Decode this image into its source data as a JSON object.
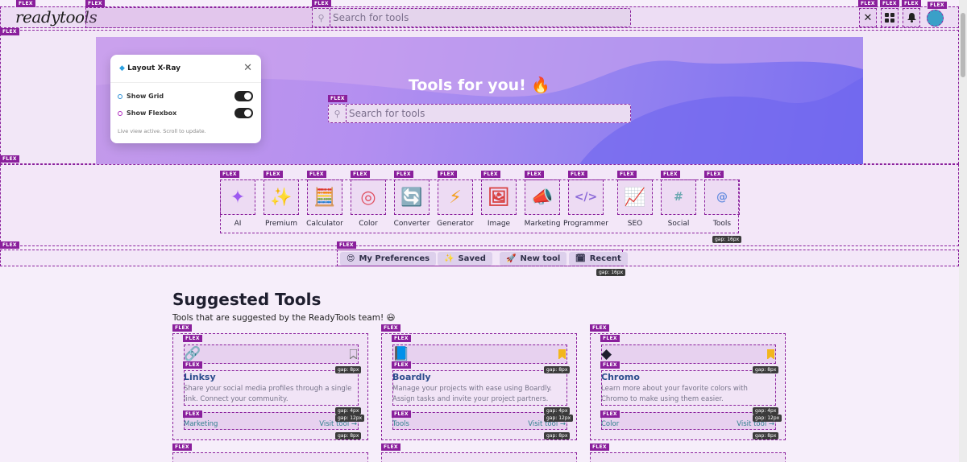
{
  "header": {
    "logo": "readytools",
    "search_placeholder": "Search for tools",
    "icons": [
      "tools-icon",
      "apps-icon",
      "bell-icon",
      "avatar"
    ]
  },
  "hero": {
    "title": "Tools for you! 🔥",
    "search_placeholder": "Search for tools"
  },
  "xray_panel": {
    "title": "Layout X-Ray",
    "show_grid": "Show Grid",
    "show_flexbox": "Show Flexbox",
    "footer": "Live view active. Scroll to update."
  },
  "categories": [
    {
      "label": "AI",
      "icon": "✦"
    },
    {
      "label": "Premium",
      "icon": "✨"
    },
    {
      "label": "Calculator",
      "icon": "🧮"
    },
    {
      "label": "Color",
      "icon": "◎"
    },
    {
      "label": "Converter",
      "icon": "🔄"
    },
    {
      "label": "Generator",
      "icon": "⚡"
    },
    {
      "label": "Image",
      "icon": "🖼"
    },
    {
      "label": "Marketing",
      "icon": "📣"
    },
    {
      "label": "Programmer",
      "icon": "</>"
    },
    {
      "label": "SEO",
      "icon": "📈"
    },
    {
      "label": "Social",
      "icon": "#"
    },
    {
      "label": "Tools",
      "icon": "@"
    }
  ],
  "preferences": [
    {
      "label": "My Preferences",
      "icon": "😍"
    },
    {
      "label": "Saved",
      "icon": "✨"
    },
    {
      "label": "New tool",
      "icon": "🚀"
    },
    {
      "label": "Recent",
      "icon": "🗓"
    }
  ],
  "overlay": {
    "flex_tag": "FLEX",
    "gap16": "gap: 16px",
    "gap8": "gap: 8px",
    "gap4": "gap: 4px",
    "gap12": "gap: 12px"
  },
  "suggested": {
    "title": "Suggested Tools",
    "subtitle": "Tools that are suggested by the ReadyTools team! 😃",
    "cards": [
      {
        "name": "Linksy",
        "description": "Share your social media profiles through a single link. Connect your community.",
        "tag": "Marketing",
        "visit": "Visit tool →",
        "saved": false
      },
      {
        "name": "Boardly",
        "description": "Manage your projects with ease using Boardly. Assign tasks and invite your project partners.",
        "tag": "Tools",
        "visit": "Visit tool →",
        "saved": true
      },
      {
        "name": "Chromo",
        "description": "Learn more about your favorite colors with Chromo to make using them easier.",
        "tag": "Color",
        "visit": "Visit tool →",
        "saved": true
      }
    ]
  },
  "colors": {
    "accent": "#8a1f9c",
    "link": "#2d7f8c",
    "title": "#2c4d8c",
    "bookmark": "#f2b61c"
  }
}
